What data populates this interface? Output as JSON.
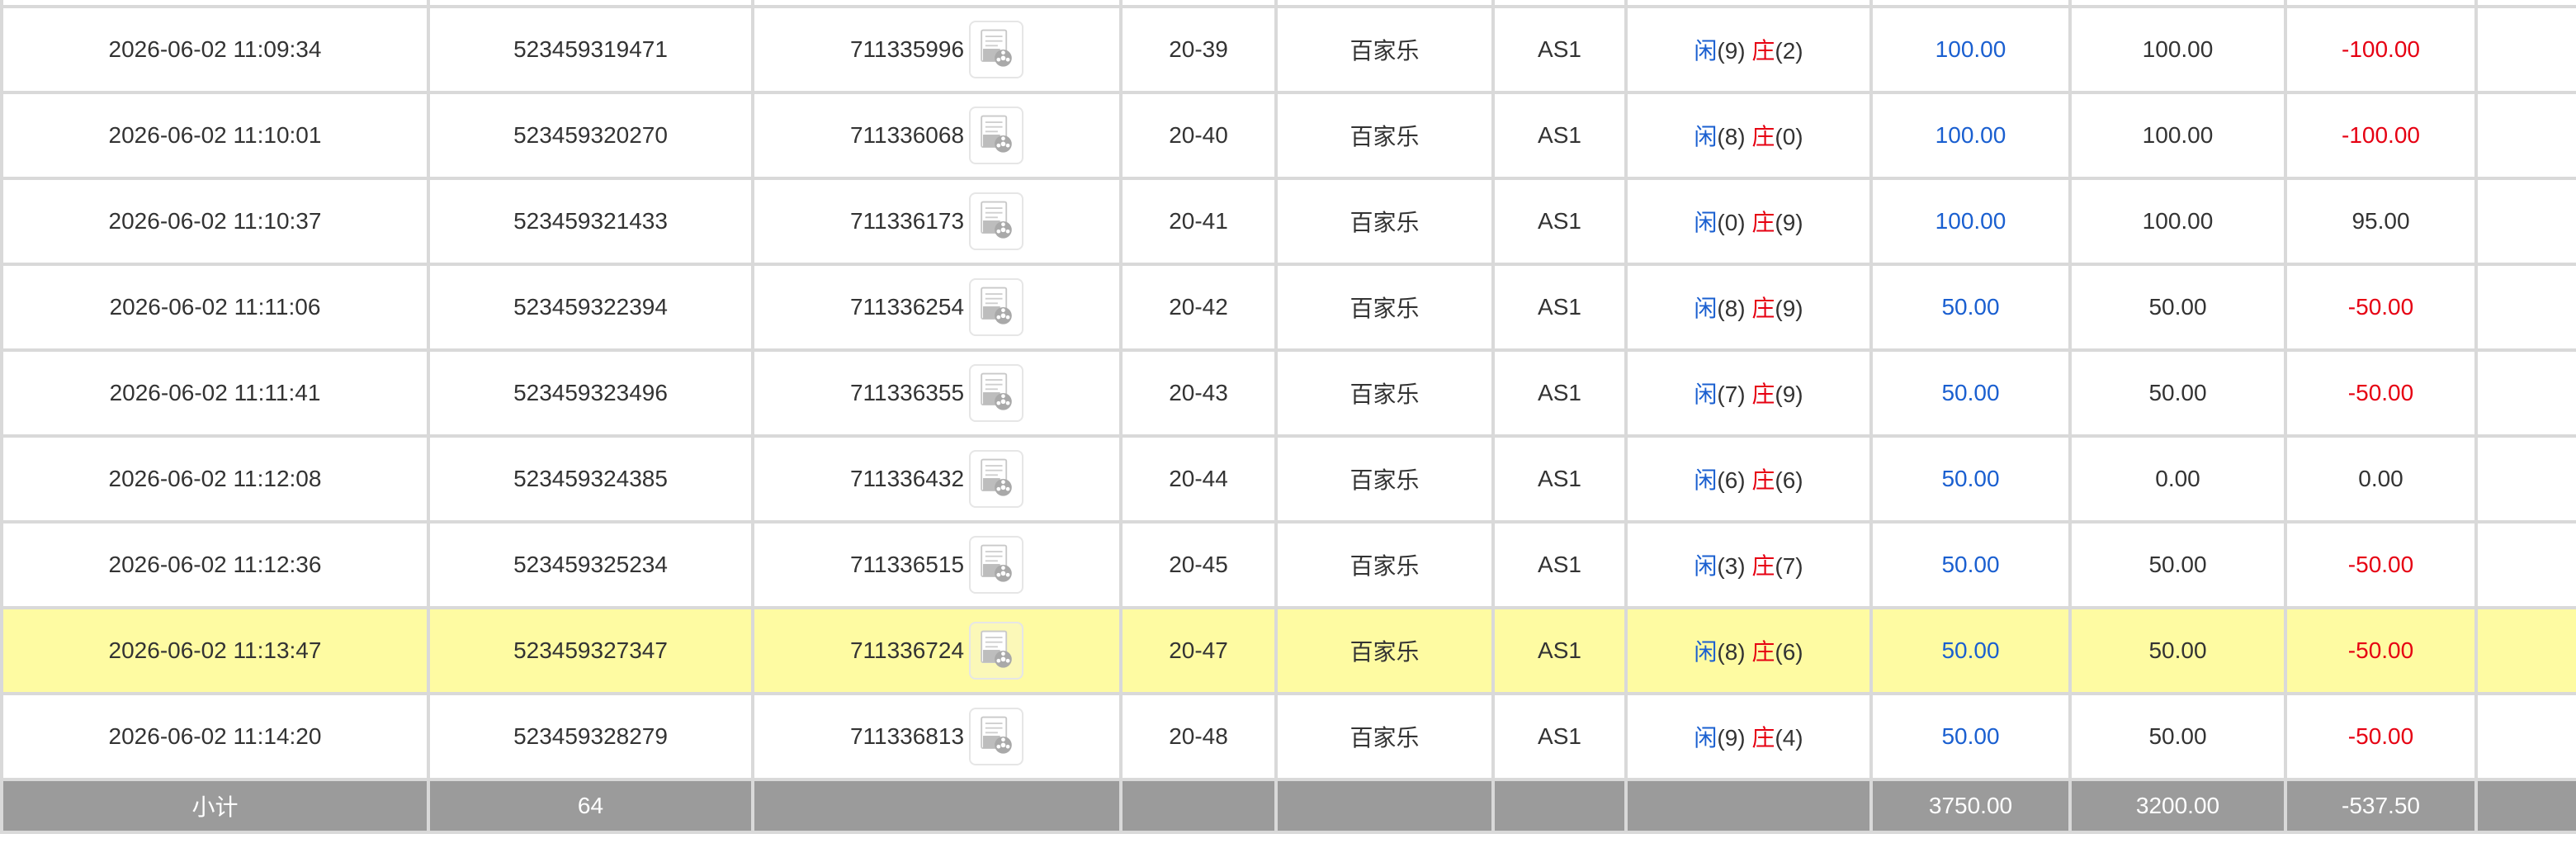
{
  "colors": {
    "player": "#1a5fd0",
    "banker": "#e60012",
    "negative": "#e60012",
    "highlight_row": "#fefba2",
    "subtotal_bg": "#9b9b9b",
    "grid": "#d9d9d9"
  },
  "icons": {
    "replay": "video-replay-icon"
  },
  "rows": [
    {
      "time": "2026-06-02 11:09:34",
      "bet_id": "523459319471",
      "round_id": "711335996",
      "shoe": "20-39",
      "game": "百家乐",
      "table": "AS1",
      "p_label": "闲",
      "p_val": "(9)",
      "b_label": "庄",
      "b_val": "(2)",
      "bet": "100.00",
      "valid": "100.00",
      "win": "-100.00",
      "win_neg": true,
      "highlight": false
    },
    {
      "time": "2026-06-02 11:10:01",
      "bet_id": "523459320270",
      "round_id": "711336068",
      "shoe": "20-40",
      "game": "百家乐",
      "table": "AS1",
      "p_label": "闲",
      "p_val": "(8)",
      "b_label": "庄",
      "b_val": "(0)",
      "bet": "100.00",
      "valid": "100.00",
      "win": "-100.00",
      "win_neg": true,
      "highlight": false
    },
    {
      "time": "2026-06-02 11:10:37",
      "bet_id": "523459321433",
      "round_id": "711336173",
      "shoe": "20-41",
      "game": "百家乐",
      "table": "AS1",
      "p_label": "闲",
      "p_val": "(0)",
      "b_label": "庄",
      "b_val": "(9)",
      "bet": "100.00",
      "valid": "100.00",
      "win": "95.00",
      "win_neg": false,
      "highlight": false
    },
    {
      "time": "2026-06-02 11:11:06",
      "bet_id": "523459322394",
      "round_id": "711336254",
      "shoe": "20-42",
      "game": "百家乐",
      "table": "AS1",
      "p_label": "闲",
      "p_val": "(8)",
      "b_label": "庄",
      "b_val": "(9)",
      "bet": "50.00",
      "valid": "50.00",
      "win": "-50.00",
      "win_neg": true,
      "highlight": false
    },
    {
      "time": "2026-06-02 11:11:41",
      "bet_id": "523459323496",
      "round_id": "711336355",
      "shoe": "20-43",
      "game": "百家乐",
      "table": "AS1",
      "p_label": "闲",
      "p_val": "(7)",
      "b_label": "庄",
      "b_val": "(9)",
      "bet": "50.00",
      "valid": "50.00",
      "win": "-50.00",
      "win_neg": true,
      "highlight": false
    },
    {
      "time": "2026-06-02 11:12:08",
      "bet_id": "523459324385",
      "round_id": "711336432",
      "shoe": "20-44",
      "game": "百家乐",
      "table": "AS1",
      "p_label": "闲",
      "p_val": "(6)",
      "b_label": "庄",
      "b_val": "(6)",
      "bet": "50.00",
      "valid": "0.00",
      "win": "0.00",
      "win_neg": false,
      "highlight": false
    },
    {
      "time": "2026-06-02 11:12:36",
      "bet_id": "523459325234",
      "round_id": "711336515",
      "shoe": "20-45",
      "game": "百家乐",
      "table": "AS1",
      "p_label": "闲",
      "p_val": "(3)",
      "b_label": "庄",
      "b_val": "(7)",
      "bet": "50.00",
      "valid": "50.00",
      "win": "-50.00",
      "win_neg": true,
      "highlight": false
    },
    {
      "time": "2026-06-02 11:13:47",
      "bet_id": "523459327347",
      "round_id": "711336724",
      "shoe": "20-47",
      "game": "百家乐",
      "table": "AS1",
      "p_label": "闲",
      "p_val": "(8)",
      "b_label": "庄",
      "b_val": "(6)",
      "bet": "50.00",
      "valid": "50.00",
      "win": "-50.00",
      "win_neg": true,
      "highlight": true
    },
    {
      "time": "2026-06-02 11:14:20",
      "bet_id": "523459328279",
      "round_id": "711336813",
      "shoe": "20-48",
      "game": "百家乐",
      "table": "AS1",
      "p_label": "闲",
      "p_val": "(9)",
      "b_label": "庄",
      "b_val": "(4)",
      "bet": "50.00",
      "valid": "50.00",
      "win": "-50.00",
      "win_neg": true,
      "highlight": false
    }
  ],
  "subtotal": {
    "label": "小计",
    "count": "64",
    "bet": "3750.00",
    "valid": "3200.00",
    "win": "-537.50"
  }
}
